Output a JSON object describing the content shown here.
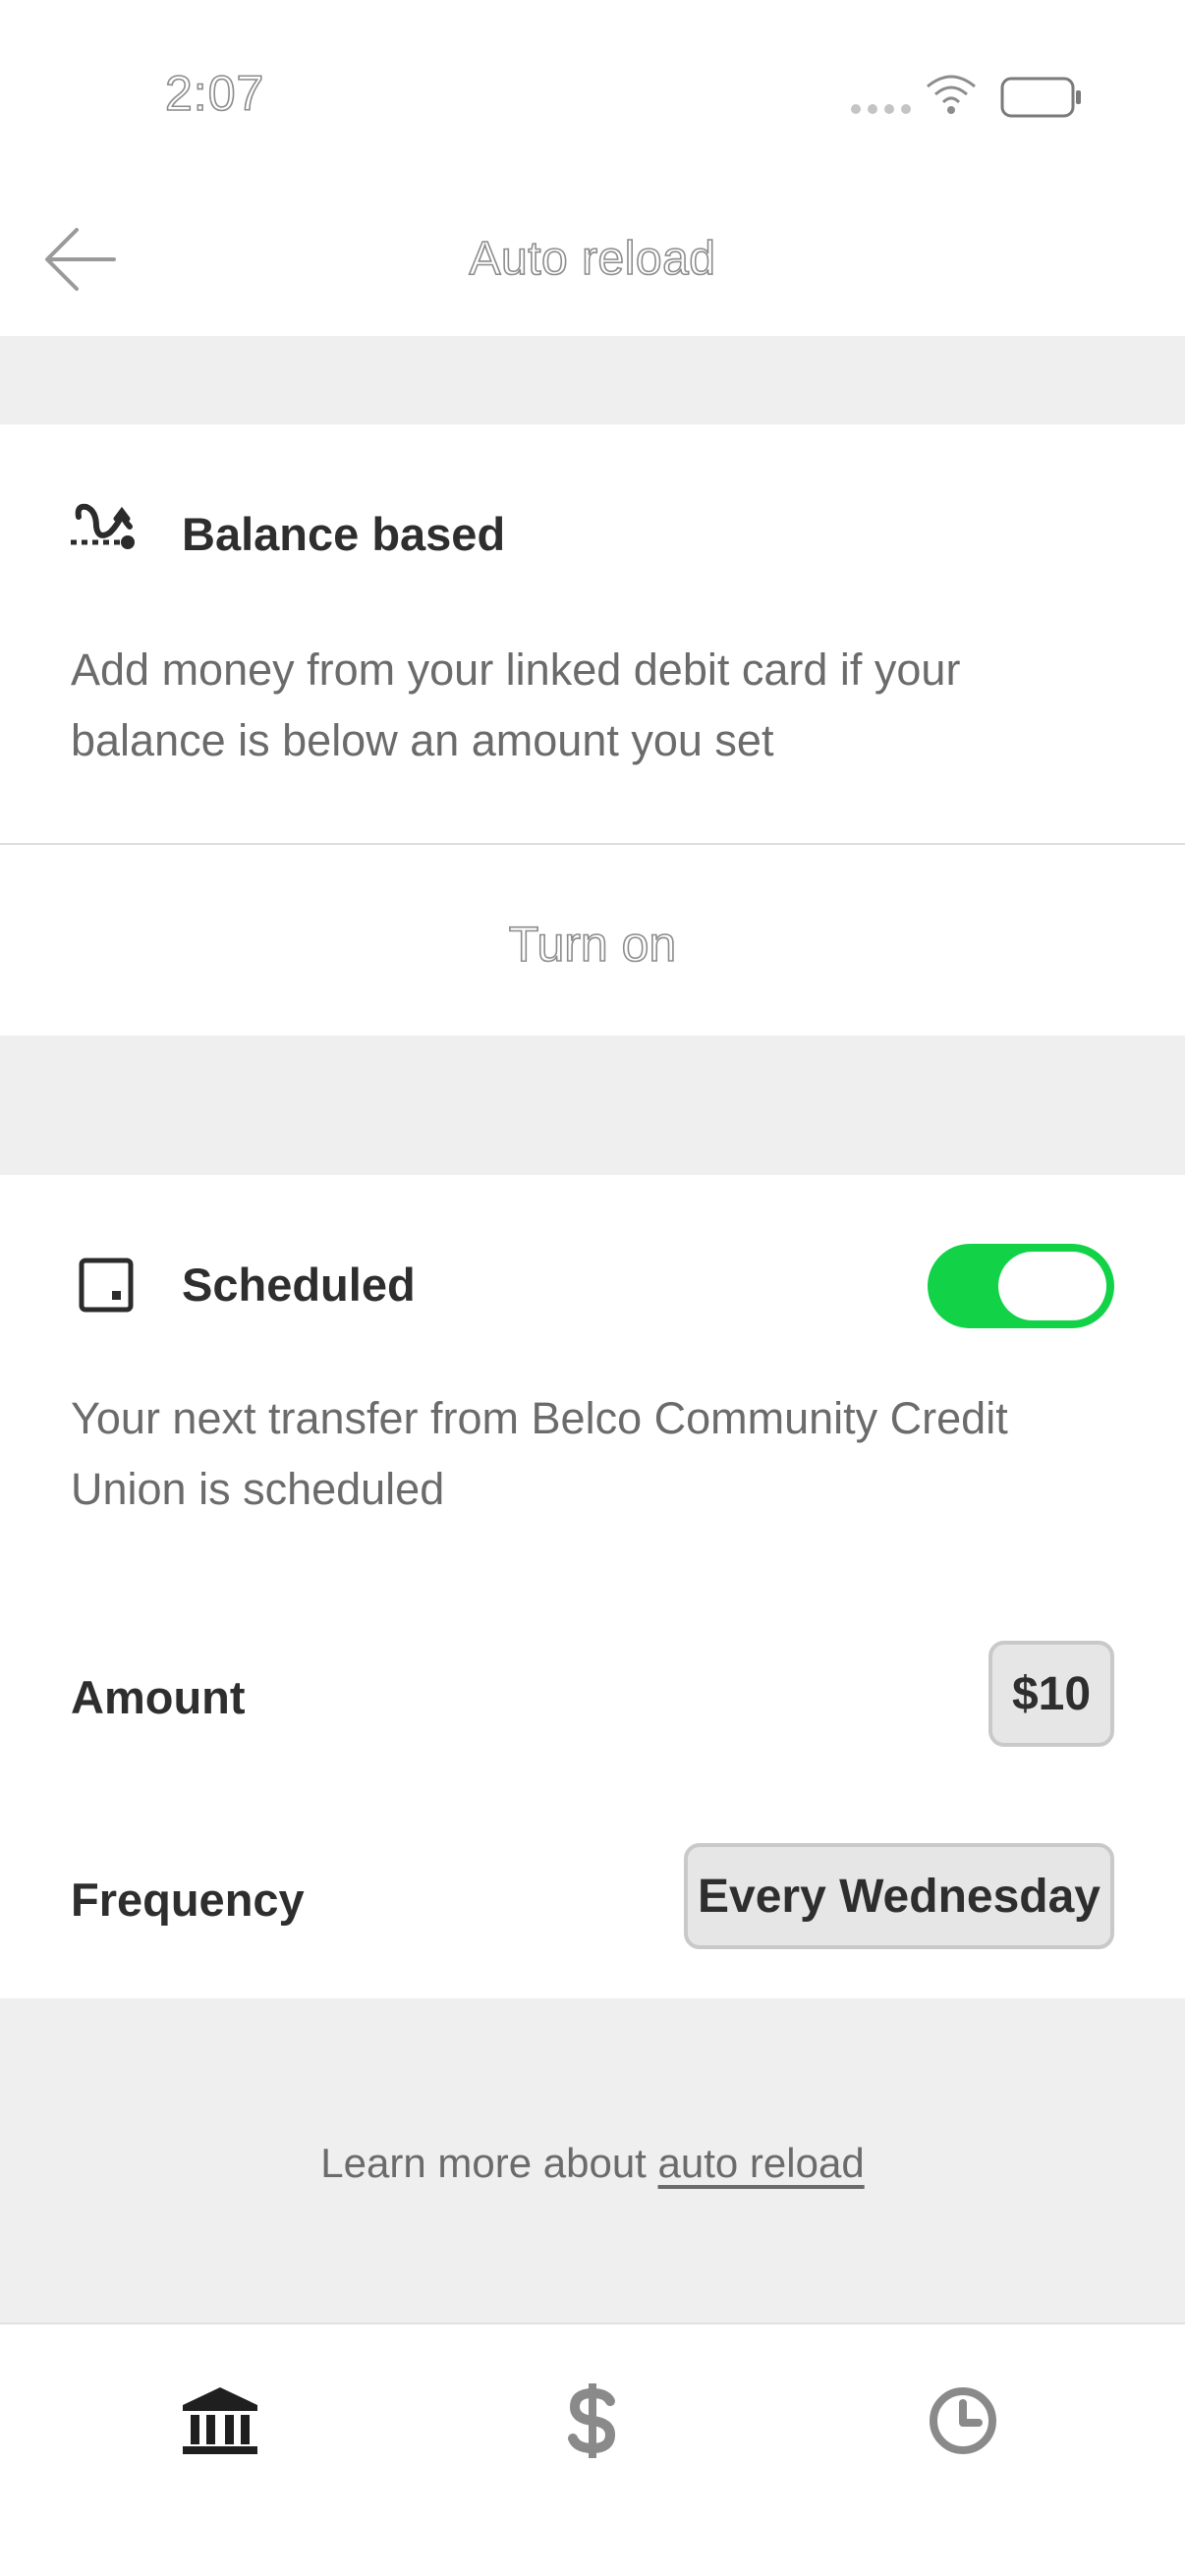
{
  "status_bar": {
    "time": "2:07"
  },
  "header": {
    "title": "Auto reload",
    "back_icon": "arrow-left-icon"
  },
  "balance_based": {
    "icon": "balance-threshold-icon",
    "title": "Balance based",
    "description": "Add money from your linked debit card if your balance is below an amount you set",
    "action_label": "Turn on"
  },
  "scheduled": {
    "icon": "calendar-square-icon",
    "title": "Scheduled",
    "toggle_on": true,
    "toggle_color": "#12d248",
    "description": "Your next transfer from Belco Community Credit Union is scheduled",
    "amount_label": "Amount",
    "amount_value": "$10",
    "frequency_label": "Frequency",
    "frequency_value": "Every Wednesday"
  },
  "footer": {
    "learn_more_prefix": "Learn more about ",
    "learn_more_link": "auto reload"
  },
  "tabbar": {
    "items": [
      "bank-icon",
      "dollar-icon",
      "clock-icon"
    ]
  }
}
